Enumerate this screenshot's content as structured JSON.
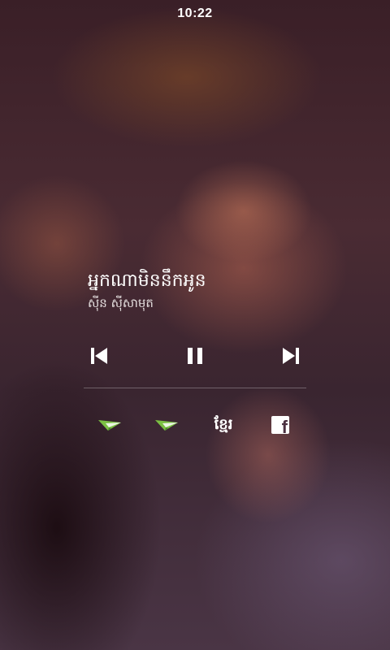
{
  "status_bar": {
    "time": "10:22"
  },
  "player": {
    "title": "អ្នកណាមិននឹកអូន",
    "artist": "ស៊ីន ស៊ីសាមុត",
    "controls": [
      {
        "name": "previous",
        "icon": "skip-previous-icon"
      },
      {
        "name": "pause",
        "icon": "pause-icon"
      },
      {
        "name": "next",
        "icon": "skip-next-icon"
      }
    ]
  },
  "actions": {
    "share_one": {
      "icon": "paper-plane-icon",
      "color": "#7bc043"
    },
    "share_two": {
      "icon": "paper-plane-icon",
      "color": "#7bc043"
    },
    "khmer_label": "ខ្មែរ",
    "facebook": {
      "icon": "facebook-icon",
      "letter": "f"
    }
  },
  "colors": {
    "accent_green": "#7bc043",
    "text_primary": "#ffffff"
  }
}
